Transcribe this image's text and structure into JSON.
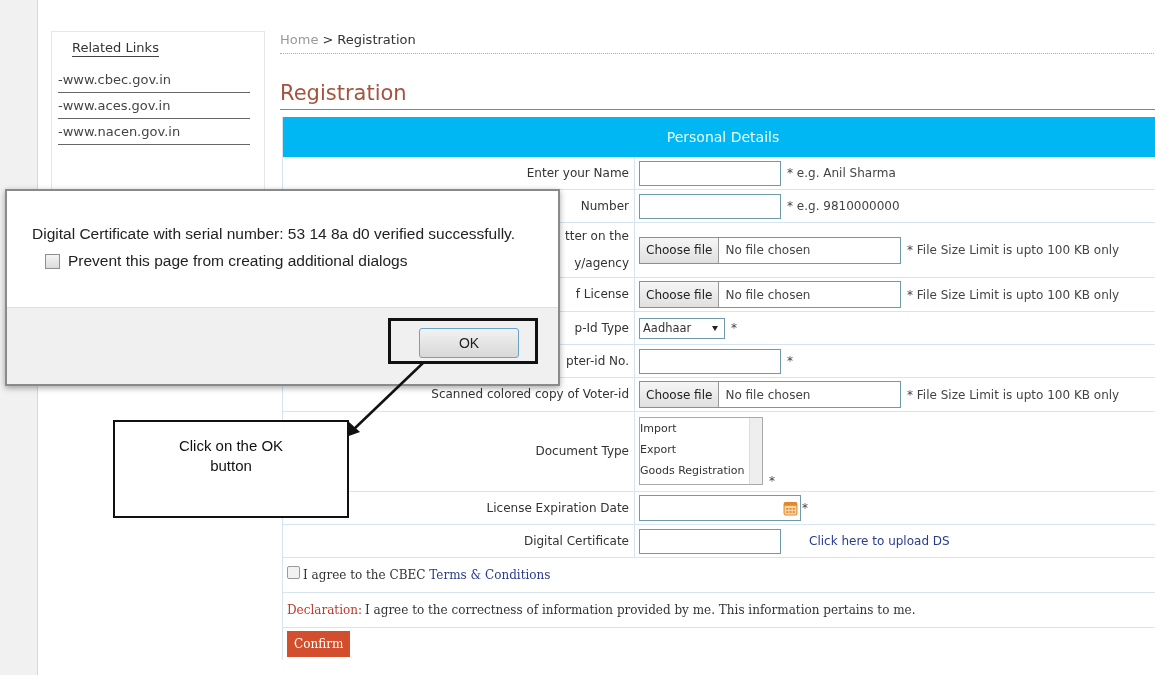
{
  "sidebar": {
    "title": "Related Links",
    "links": [
      {
        "text": "-www.cbec.gov.in"
      },
      {
        "text": "-www.aces.gov.in"
      },
      {
        "text": "-www.nacen.gov.in"
      }
    ]
  },
  "breadcrumb": {
    "home": "Home",
    "separator": ">",
    "current": "Registration"
  },
  "page_title": "Registration",
  "form": {
    "header": "Personal Details",
    "rows": [
      {
        "kind": "text",
        "label": [
          "Enter your Name"
        ],
        "hint": "* e.g. Anil Sharma"
      },
      {
        "kind": "text",
        "label": [
          "Number"
        ],
        "hint": "* e.g. 9810000000"
      },
      {
        "kind": "file",
        "label": [
          "tter on the",
          "y/agency"
        ],
        "button": "Choose file",
        "status": "No file chosen",
        "hint": "* File Size Limit is upto 100 KB only"
      },
      {
        "kind": "file",
        "label": [
          "f License"
        ],
        "button": "Choose file",
        "status": "No file chosen",
        "hint": "* File Size Limit is upto 100 KB only"
      },
      {
        "kind": "select",
        "label": [
          "p-Id Type"
        ],
        "value": "Aadhaar",
        "hint": "*"
      },
      {
        "kind": "text",
        "label": [
          "pter-id No."
        ],
        "hint": "*"
      },
      {
        "kind": "file",
        "label": [
          "Scanned colored copy of Voter-id"
        ],
        "button": "Choose file",
        "status": "No file chosen",
        "hint": "* File Size Limit is upto 100 KB only"
      },
      {
        "kind": "listbox",
        "label": [
          "Document Type"
        ],
        "options": [
          "Import",
          "Export",
          "Goods Registration"
        ],
        "hint": "*"
      },
      {
        "kind": "date",
        "label": [
          "License Expiration Date"
        ],
        "hint": "*"
      },
      {
        "kind": "upload",
        "label": [
          "Digital Certificate"
        ],
        "link": "Click here to upload DS"
      }
    ],
    "agree": {
      "checked": false,
      "text": "I agree to the CBEC ",
      "link": "Terms & Conditions"
    },
    "declaration": {
      "label": "Declaration:",
      "text": "I agree to the correctness of information provided by me. This information pertains to me."
    },
    "confirm": "Confirm"
  },
  "dialog": {
    "message": "Digital Certificate with serial number: 53 14 8a d0 verified successfully.",
    "prevent": {
      "checked": false,
      "label": "Prevent this page from creating additional dialogs"
    },
    "ok": "OK"
  },
  "annotation": {
    "callout": "Click on the OK button"
  }
}
